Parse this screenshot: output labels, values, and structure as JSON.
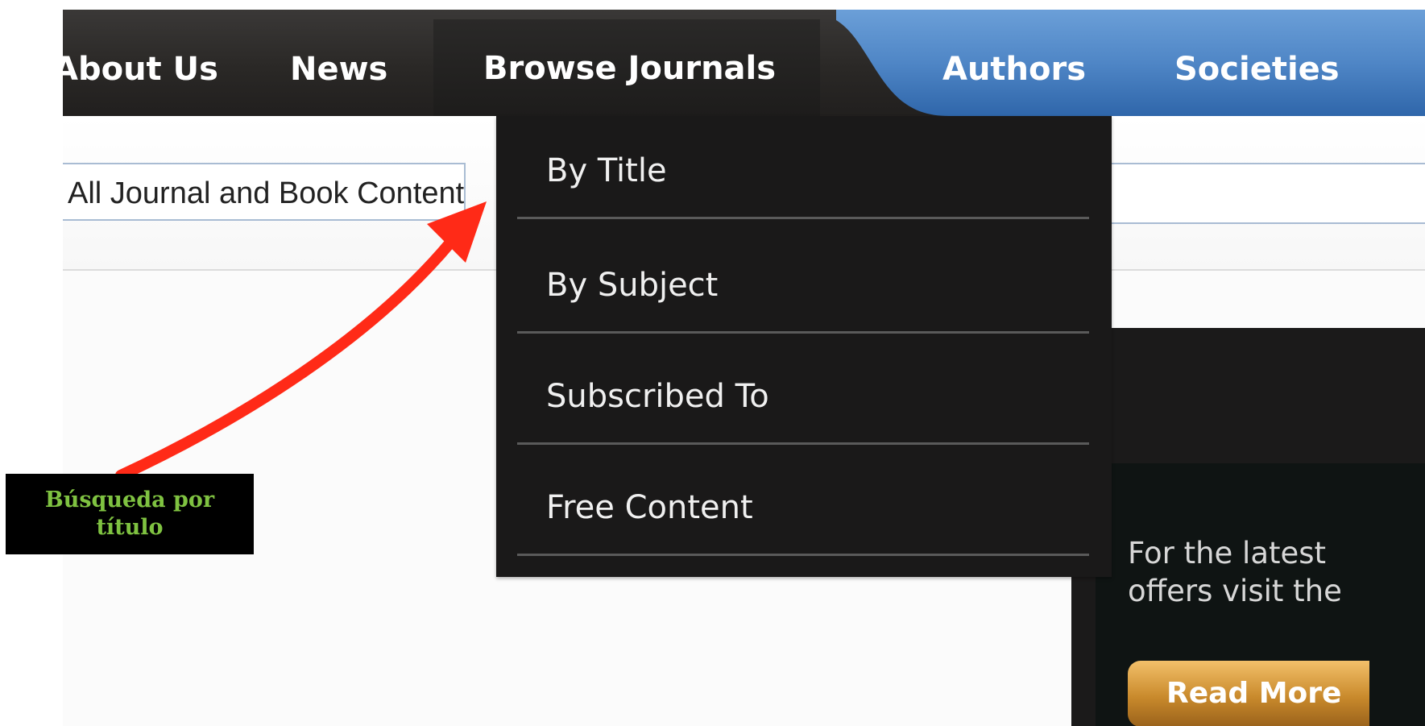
{
  "nav": {
    "items": [
      {
        "label": "About Us"
      },
      {
        "label": "News"
      },
      {
        "label": "Browse Journals"
      },
      {
        "label": "Authors"
      },
      {
        "label": "Societies"
      }
    ]
  },
  "search": {
    "scope_value": "All Journal and Book Content",
    "query_value": ""
  },
  "dropdown": {
    "items": [
      {
        "label": "By Title"
      },
      {
        "label": "By Subject"
      },
      {
        "label": "Subscribed To"
      },
      {
        "label": "Free Content"
      }
    ]
  },
  "promo": {
    "text_line1": "For the latest",
    "text_line2": "offers visit the",
    "button_label": "Read More"
  },
  "annotation": {
    "line1": "Búsqueda por",
    "line2": "título",
    "text_color": "#7fc241",
    "arrow_color": "#ff2a17"
  },
  "colors": {
    "nav_dark": "#2a2826",
    "nav_blue": "#4f86c6",
    "dropdown_bg": "#1a1919",
    "button_gold": "#c98a2c"
  }
}
